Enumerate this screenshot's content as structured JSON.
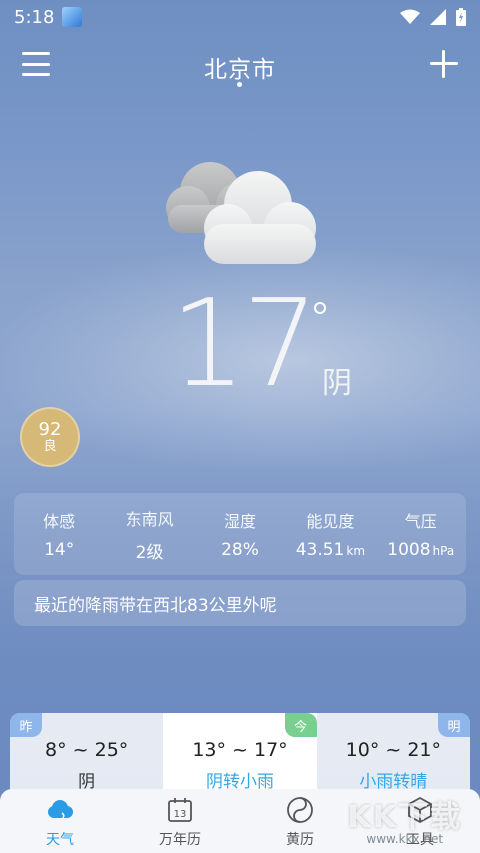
{
  "status_bar": {
    "time": "5:18"
  },
  "header": {
    "city": "北京市"
  },
  "current": {
    "temperature": "17",
    "condition": "阴",
    "aqi_value": "92",
    "aqi_level": "良"
  },
  "details": [
    {
      "label": "体感",
      "value": "14°",
      "unit": ""
    },
    {
      "label": "东南风",
      "value": "2级",
      "unit": ""
    },
    {
      "label": "湿度",
      "value": "28%",
      "unit": ""
    },
    {
      "label": "能见度",
      "value": "43.51",
      "unit": "km"
    },
    {
      "label": "气压",
      "value": "1008",
      "unit": "hPa"
    }
  ],
  "notice": "最近的降雨带在西北83公里外呢",
  "forecast": [
    {
      "badge": "昨",
      "temp": "8° ~ 25°",
      "condition": "阴"
    },
    {
      "badge": "今",
      "temp": "13° ~ 17°",
      "condition": "阴转小雨"
    },
    {
      "badge": "明",
      "temp": "10° ~ 21°",
      "condition": "小雨转晴"
    }
  ],
  "tabs": [
    {
      "label": "天气",
      "icon": "cloud-icon",
      "calendar_day": ""
    },
    {
      "label": "万年历",
      "icon": "calendar-icon",
      "calendar_day": "13"
    },
    {
      "label": "黄历",
      "icon": "yin-yang-icon",
      "calendar_day": ""
    },
    {
      "label": "工具",
      "icon": "cube-icon",
      "calendar_day": ""
    }
  ],
  "watermark": {
    "big": "KK下载",
    "small": "www.kkx.net"
  },
  "colors": {
    "accent": "#2b9be6",
    "aqi_badge": "#d6b877",
    "badge_blue": "#8fb6ea",
    "badge_green": "#79cf8f"
  }
}
